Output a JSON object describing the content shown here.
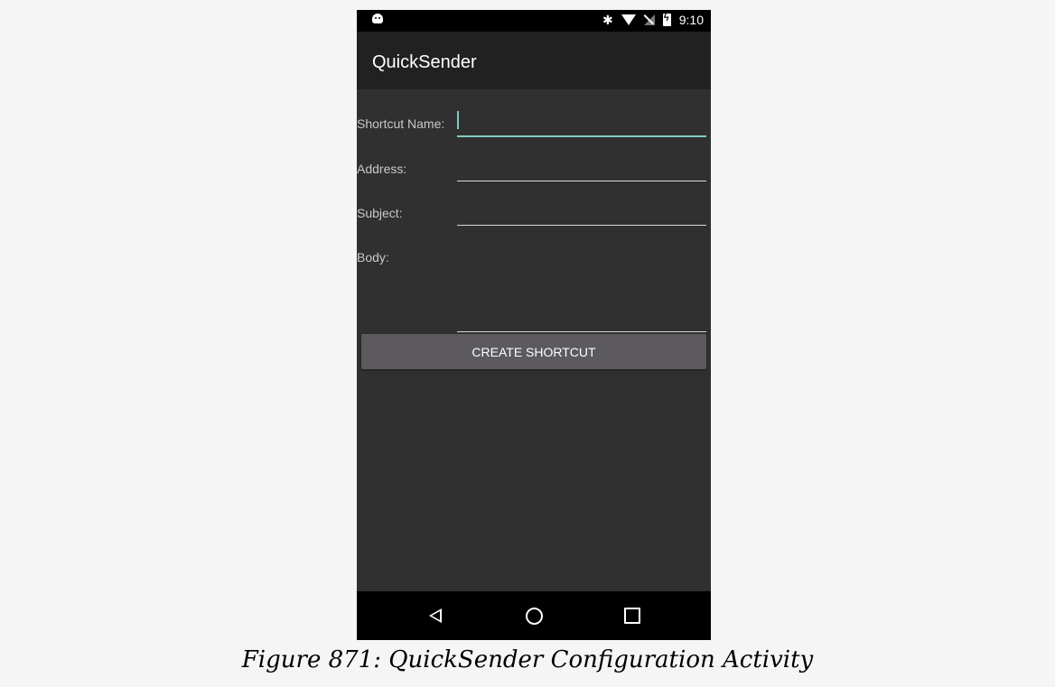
{
  "status_bar": {
    "time": "9:10",
    "icons": [
      "android-icon",
      "bluetooth-icon",
      "wifi-icon",
      "no-signal-icon",
      "battery-charging-icon"
    ]
  },
  "app_bar": {
    "title": "QuickSender"
  },
  "form": {
    "shortcut_name_label": "Shortcut Name:",
    "shortcut_name_value": "",
    "address_label": "Address:",
    "address_value": "",
    "subject_label": "Subject:",
    "subject_value": "",
    "body_label": "Body:",
    "body_value": "",
    "create_button_label": "CREATE SHORTCUT"
  },
  "nav_bar": {
    "icons": [
      "back-icon",
      "home-icon",
      "recents-icon"
    ]
  },
  "caption": "Figure 871: QuickSender Configuration Activity",
  "colors": {
    "accent": "#80cbc4",
    "window_bg": "#303030",
    "app_bar": "#212121",
    "button": "#5c5a5e"
  }
}
